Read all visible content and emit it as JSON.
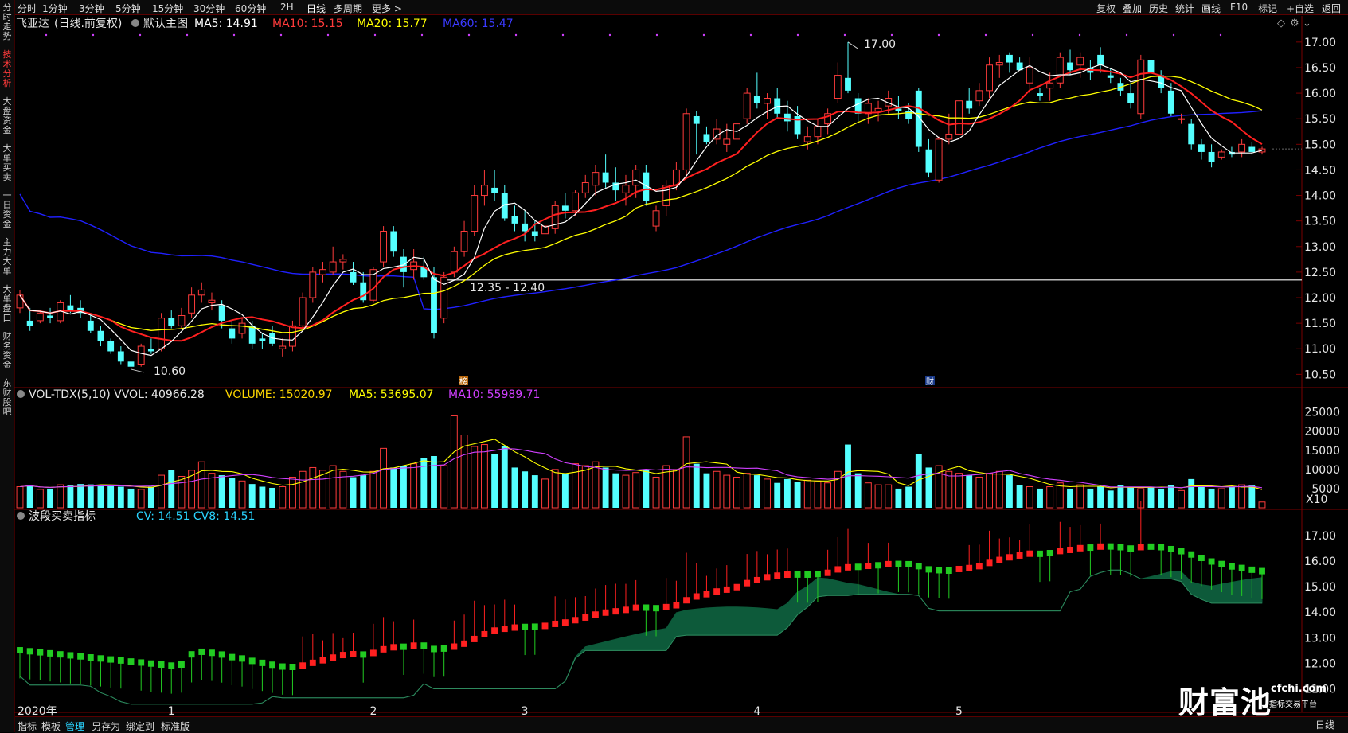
{
  "sidebar": {
    "items": [
      {
        "label": "分时走势",
        "active": false
      },
      {
        "label": "技术分析",
        "active": true
      },
      {
        "label": "大盘资金",
        "active": false
      },
      {
        "label": "大单买卖",
        "active": false
      },
      {
        "label": "一日资金",
        "active": false
      },
      {
        "label": "主力大单",
        "active": false
      },
      {
        "label": "大单盘口",
        "active": false
      },
      {
        "label": "财务资金",
        "active": false
      },
      {
        "label": "东财股吧",
        "active": false
      }
    ]
  },
  "toolbar": {
    "periods": [
      "分时",
      "1分钟",
      "3分钟",
      "5分钟",
      "15分钟",
      "30分钟",
      "60分钟",
      "2H",
      "日线",
      "多周期",
      "更多 >"
    ],
    "active_period": "日线",
    "right_items": [
      "复权",
      "叠加",
      "历史",
      "统计",
      "画线",
      "F10",
      "标记",
      "+自选",
      "返回"
    ]
  },
  "main_chart": {
    "stock_name": "飞亚达",
    "period_label": "(日线.前复权)",
    "template": "默认主图",
    "ma5": "MA5: 14.91",
    "ma10": "MA10: 15.15",
    "ma20": "MA20: 15.77",
    "ma60": "MA60: 15.47",
    "y_labels": [
      "17.00",
      "16.50",
      "16.00",
      "15.50",
      "15.00",
      "14.50",
      "14.00",
      "13.50",
      "13.00",
      "12.50",
      "12.00",
      "11.50",
      "11.00",
      "10.50"
    ],
    "y_range": [
      10.35,
      17.2
    ],
    "high_label": "17.00",
    "low_label": "10.60",
    "range_label": "12.35 - 12.40",
    "support_level": 12.35,
    "marker_bang": "榜",
    "marker_cai": "财",
    "colors": {
      "up": "#ff3b3b",
      "down": "#54ffff",
      "ma5": "#ffffff",
      "ma10": "#ff2020",
      "ma20": "#ffff00",
      "ma60": "#2020ff"
    }
  },
  "volume_panel": {
    "title": "VOL-TDX(5,10) VVOL: 40966.28",
    "volume": "VOLUME: 15020.97",
    "ma5": "MA5: 53695.07",
    "ma10": "MA10: 55989.71",
    "y_labels": [
      "25000",
      "20000",
      "15000",
      "10000",
      "5000"
    ],
    "unit": "X10",
    "y_max": 27000
  },
  "indicator_panel": {
    "title": "波段买卖指标",
    "values": "CV: 14.51  CV8: 14.51",
    "y_labels": [
      "17.00",
      "16.00",
      "15.00",
      "14.00",
      "13.00",
      "12.00",
      "11.00"
    ],
    "y_range": [
      10.3,
      17.4
    ]
  },
  "x_axis": {
    "labels": [
      {
        "label": "2020年",
        "index": 0
      },
      {
        "label": "1",
        "index": 15
      },
      {
        "label": "2",
        "index": 35
      },
      {
        "label": "3",
        "index": 50
      },
      {
        "label": "4",
        "index": 73
      },
      {
        "label": "5",
        "index": 93
      }
    ]
  },
  "chart_data": {
    "type": "candlestick",
    "candles": [
      {
        "o": 11.8,
        "h": 12.15,
        "l": 11.7,
        "c": 12.05,
        "v": 5500
      },
      {
        "o": 11.55,
        "h": 11.8,
        "l": 11.35,
        "c": 11.45,
        "v": 6000
      },
      {
        "o": 11.55,
        "h": 11.75,
        "l": 11.5,
        "c": 11.7,
        "v": 4800
      },
      {
        "o": 11.65,
        "h": 11.8,
        "l": 11.5,
        "c": 11.6,
        "v": 5000
      },
      {
        "o": 11.55,
        "h": 11.95,
        "l": 11.5,
        "c": 11.9,
        "v": 6000
      },
      {
        "o": 11.85,
        "h": 12.05,
        "l": 11.7,
        "c": 11.75,
        "v": 5800
      },
      {
        "o": 11.8,
        "h": 11.95,
        "l": 11.6,
        "c": 11.7,
        "v": 6200
      },
      {
        "o": 11.55,
        "h": 11.65,
        "l": 11.3,
        "c": 11.35,
        "v": 6100
      },
      {
        "o": 11.35,
        "h": 11.45,
        "l": 11.05,
        "c": 11.15,
        "v": 6000
      },
      {
        "o": 11.15,
        "h": 11.2,
        "l": 10.9,
        "c": 10.95,
        "v": 5800
      },
      {
        "o": 10.95,
        "h": 11.05,
        "l": 10.7,
        "c": 10.75,
        "v": 5500
      },
      {
        "o": 10.75,
        "h": 10.9,
        "l": 10.6,
        "c": 10.65,
        "v": 5000
      },
      {
        "o": 10.7,
        "h": 11.1,
        "l": 10.65,
        "c": 11.05,
        "v": 4800
      },
      {
        "o": 11.0,
        "h": 11.2,
        "l": 10.9,
        "c": 10.95,
        "v": 5500
      },
      {
        "o": 11.0,
        "h": 11.7,
        "l": 10.95,
        "c": 11.6,
        "v": 8500
      },
      {
        "o": 11.6,
        "h": 11.75,
        "l": 11.4,
        "c": 11.45,
        "v": 9800
      },
      {
        "o": 11.45,
        "h": 11.8,
        "l": 11.4,
        "c": 11.65,
        "v": 8200
      },
      {
        "o": 11.7,
        "h": 12.2,
        "l": 11.6,
        "c": 12.05,
        "v": 9800
      },
      {
        "o": 12.05,
        "h": 12.3,
        "l": 11.9,
        "c": 12.15,
        "v": 12000
      },
      {
        "o": 11.9,
        "h": 12.1,
        "l": 11.75,
        "c": 11.95,
        "v": 9000
      },
      {
        "o": 11.85,
        "h": 11.95,
        "l": 11.4,
        "c": 11.55,
        "v": 8500
      },
      {
        "o": 11.4,
        "h": 11.55,
        "l": 11.1,
        "c": 11.2,
        "v": 7800
      },
      {
        "o": 11.3,
        "h": 11.6,
        "l": 11.2,
        "c": 11.5,
        "v": 7000
      },
      {
        "o": 11.45,
        "h": 11.55,
        "l": 11.0,
        "c": 11.1,
        "v": 6200
      },
      {
        "o": 11.2,
        "h": 11.3,
        "l": 11.0,
        "c": 11.15,
        "v": 5500
      },
      {
        "o": 11.3,
        "h": 11.45,
        "l": 11.05,
        "c": 11.1,
        "v": 5200
      },
      {
        "o": 11.0,
        "h": 11.2,
        "l": 10.85,
        "c": 11.05,
        "v": 5500
      },
      {
        "o": 11.05,
        "h": 11.55,
        "l": 10.95,
        "c": 11.45,
        "v": 8000
      },
      {
        "o": 11.45,
        "h": 12.1,
        "l": 11.4,
        "c": 12.0,
        "v": 9500
      },
      {
        "o": 12.0,
        "h": 12.6,
        "l": 11.9,
        "c": 12.5,
        "v": 10500
      },
      {
        "o": 12.45,
        "h": 12.7,
        "l": 12.3,
        "c": 12.55,
        "v": 9800
      },
      {
        "o": 12.5,
        "h": 13.0,
        "l": 12.45,
        "c": 12.7,
        "v": 11000
      },
      {
        "o": 12.7,
        "h": 12.85,
        "l": 12.55,
        "c": 12.75,
        "v": 9500
      },
      {
        "o": 12.5,
        "h": 12.7,
        "l": 12.25,
        "c": 12.3,
        "v": 8000
      },
      {
        "o": 12.3,
        "h": 12.5,
        "l": 11.9,
        "c": 11.95,
        "v": 8500
      },
      {
        "o": 11.95,
        "h": 12.6,
        "l": 11.9,
        "c": 12.55,
        "v": 9500
      },
      {
        "o": 12.7,
        "h": 13.4,
        "l": 12.6,
        "c": 13.3,
        "v": 15500
      },
      {
        "o": 13.3,
        "h": 13.4,
        "l": 12.8,
        "c": 12.9,
        "v": 10500
      },
      {
        "o": 12.8,
        "h": 12.95,
        "l": 12.2,
        "c": 12.5,
        "v": 11000
      },
      {
        "o": 12.55,
        "h": 12.95,
        "l": 12.35,
        "c": 12.7,
        "v": 11500
      },
      {
        "o": 12.6,
        "h": 12.8,
        "l": 12.35,
        "c": 12.4,
        "v": 13000
      },
      {
        "o": 12.4,
        "h": 12.6,
        "l": 11.2,
        "c": 11.3,
        "v": 13500
      },
      {
        "o": 11.6,
        "h": 12.5,
        "l": 11.5,
        "c": 12.4,
        "v": 11000
      },
      {
        "o": 12.5,
        "h": 13.0,
        "l": 12.4,
        "c": 12.9,
        "v": 24000
      },
      {
        "o": 12.9,
        "h": 13.5,
        "l": 12.8,
        "c": 13.3,
        "v": 19000
      },
      {
        "o": 13.3,
        "h": 14.2,
        "l": 13.2,
        "c": 14.0,
        "v": 16000
      },
      {
        "o": 14.0,
        "h": 14.5,
        "l": 13.8,
        "c": 14.2,
        "v": 16500
      },
      {
        "o": 14.15,
        "h": 14.5,
        "l": 13.9,
        "c": 14.05,
        "v": 14000
      },
      {
        "o": 14.05,
        "h": 14.2,
        "l": 13.5,
        "c": 13.55,
        "v": 16000
      },
      {
        "o": 13.6,
        "h": 13.8,
        "l": 13.3,
        "c": 13.45,
        "v": 10500
      },
      {
        "o": 13.45,
        "h": 13.7,
        "l": 13.1,
        "c": 13.3,
        "v": 9500
      },
      {
        "o": 13.3,
        "h": 13.5,
        "l": 13.1,
        "c": 13.2,
        "v": 8500
      },
      {
        "o": 13.25,
        "h": 13.5,
        "l": 12.7,
        "c": 13.4,
        "v": 7500
      },
      {
        "o": 13.35,
        "h": 13.9,
        "l": 13.25,
        "c": 13.8,
        "v": 10000
      },
      {
        "o": 13.8,
        "h": 14.05,
        "l": 13.55,
        "c": 13.7,
        "v": 9000
      },
      {
        "o": 13.7,
        "h": 14.1,
        "l": 13.6,
        "c": 14.05,
        "v": 11500
      },
      {
        "o": 14.05,
        "h": 14.4,
        "l": 13.95,
        "c": 14.25,
        "v": 11000
      },
      {
        "o": 14.2,
        "h": 14.6,
        "l": 14.0,
        "c": 14.45,
        "v": 12000
      },
      {
        "o": 14.45,
        "h": 14.8,
        "l": 14.15,
        "c": 14.25,
        "v": 10500
      },
      {
        "o": 14.25,
        "h": 14.55,
        "l": 13.9,
        "c": 14.1,
        "v": 9000
      },
      {
        "o": 14.05,
        "h": 14.4,
        "l": 13.8,
        "c": 14.2,
        "v": 8500
      },
      {
        "o": 14.2,
        "h": 14.6,
        "l": 13.95,
        "c": 14.5,
        "v": 9200
      },
      {
        "o": 14.45,
        "h": 14.6,
        "l": 13.8,
        "c": 13.9,
        "v": 10000
      },
      {
        "o": 13.4,
        "h": 13.8,
        "l": 13.3,
        "c": 13.7,
        "v": 8000
      },
      {
        "o": 13.8,
        "h": 14.3,
        "l": 13.6,
        "c": 14.2,
        "v": 11000
      },
      {
        "o": 14.2,
        "h": 14.65,
        "l": 14.1,
        "c": 14.5,
        "v": 10000
      },
      {
        "o": 14.5,
        "h": 15.7,
        "l": 14.4,
        "c": 15.6,
        "v": 18500
      },
      {
        "o": 15.55,
        "h": 15.65,
        "l": 14.8,
        "c": 15.4,
        "v": 11500
      },
      {
        "o": 15.2,
        "h": 15.35,
        "l": 15.0,
        "c": 15.05,
        "v": 9000
      },
      {
        "o": 15.1,
        "h": 15.5,
        "l": 15.0,
        "c": 15.3,
        "v": 9500
      },
      {
        "o": 15.0,
        "h": 15.4,
        "l": 14.85,
        "c": 15.1,
        "v": 8500
      },
      {
        "o": 15.1,
        "h": 15.5,
        "l": 14.95,
        "c": 15.4,
        "v": 8000
      },
      {
        "o": 15.5,
        "h": 16.1,
        "l": 15.4,
        "c": 16.0,
        "v": 9000
      },
      {
        "o": 15.95,
        "h": 16.4,
        "l": 15.7,
        "c": 15.8,
        "v": 8500
      },
      {
        "o": 15.8,
        "h": 16.0,
        "l": 15.5,
        "c": 15.9,
        "v": 7500
      },
      {
        "o": 15.9,
        "h": 16.1,
        "l": 15.5,
        "c": 15.6,
        "v": 6500
      },
      {
        "o": 15.6,
        "h": 15.85,
        "l": 15.25,
        "c": 15.45,
        "v": 7500
      },
      {
        "o": 15.55,
        "h": 15.75,
        "l": 15.1,
        "c": 15.2,
        "v": 6800
      },
      {
        "o": 15.05,
        "h": 15.35,
        "l": 14.9,
        "c": 15.15,
        "v": 7200
      },
      {
        "o": 15.15,
        "h": 15.5,
        "l": 15.0,
        "c": 15.35,
        "v": 7000
      },
      {
        "o": 15.4,
        "h": 15.7,
        "l": 15.2,
        "c": 15.6,
        "v": 6500
      },
      {
        "o": 15.9,
        "h": 16.6,
        "l": 15.8,
        "c": 16.35,
        "v": 9500
      },
      {
        "o": 16.3,
        "h": 17.0,
        "l": 16.0,
        "c": 16.05,
        "v": 16500
      },
      {
        "o": 15.9,
        "h": 16.0,
        "l": 15.45,
        "c": 15.6,
        "v": 9000
      },
      {
        "o": 15.6,
        "h": 15.9,
        "l": 15.4,
        "c": 15.8,
        "v": 6500
      },
      {
        "o": 15.65,
        "h": 15.85,
        "l": 15.45,
        "c": 15.7,
        "v": 6000
      },
      {
        "o": 15.75,
        "h": 16.05,
        "l": 15.6,
        "c": 15.9,
        "v": 6000
      },
      {
        "o": 15.7,
        "h": 15.95,
        "l": 15.5,
        "c": 15.65,
        "v": 5000
      },
      {
        "o": 15.65,
        "h": 15.8,
        "l": 15.4,
        "c": 15.5,
        "v": 5500
      },
      {
        "o": 16.05,
        "h": 16.1,
        "l": 14.85,
        "c": 14.95,
        "v": 14000
      },
      {
        "o": 14.9,
        "h": 15.1,
        "l": 14.35,
        "c": 14.45,
        "v": 10500
      },
      {
        "o": 14.3,
        "h": 15.15,
        "l": 14.25,
        "c": 15.1,
        "v": 11000
      },
      {
        "o": 15.1,
        "h": 15.6,
        "l": 15.0,
        "c": 15.2,
        "v": 9500
      },
      {
        "o": 15.2,
        "h": 15.95,
        "l": 15.1,
        "c": 15.85,
        "v": 9000
      },
      {
        "o": 15.85,
        "h": 16.1,
        "l": 15.6,
        "c": 15.7,
        "v": 8500
      },
      {
        "o": 15.85,
        "h": 16.2,
        "l": 15.75,
        "c": 16.05,
        "v": 8000
      },
      {
        "o": 16.05,
        "h": 16.7,
        "l": 15.9,
        "c": 16.55,
        "v": 9000
      },
      {
        "o": 16.55,
        "h": 16.75,
        "l": 16.3,
        "c": 16.6,
        "v": 9500
      },
      {
        "o": 16.75,
        "h": 16.8,
        "l": 16.4,
        "c": 16.6,
        "v": 8500
      },
      {
        "o": 16.6,
        "h": 16.7,
        "l": 16.45,
        "c": 16.45,
        "v": 6000
      },
      {
        "o": 16.2,
        "h": 16.7,
        "l": 16.0,
        "c": 16.5,
        "v": 5500
      },
      {
        "o": 16.0,
        "h": 16.1,
        "l": 15.85,
        "c": 15.95,
        "v": 5000
      },
      {
        "o": 16.1,
        "h": 16.4,
        "l": 15.85,
        "c": 16.2,
        "v": 5500
      },
      {
        "o": 16.2,
        "h": 16.8,
        "l": 16.1,
        "c": 16.7,
        "v": 6500
      },
      {
        "o": 16.6,
        "h": 16.85,
        "l": 16.35,
        "c": 16.45,
        "v": 5000
      },
      {
        "o": 16.55,
        "h": 16.8,
        "l": 16.3,
        "c": 16.7,
        "v": 6000
      },
      {
        "o": 16.5,
        "h": 16.65,
        "l": 16.25,
        "c": 16.4,
        "v": 5000
      },
      {
        "o": 16.75,
        "h": 16.9,
        "l": 16.4,
        "c": 16.55,
        "v": 5500
      },
      {
        "o": 16.35,
        "h": 16.5,
        "l": 16.2,
        "c": 16.3,
        "v": 4500
      },
      {
        "o": 16.2,
        "h": 16.3,
        "l": 15.95,
        "c": 16.05,
        "v": 6000
      },
      {
        "o": 16.0,
        "h": 16.2,
        "l": 15.7,
        "c": 15.8,
        "v": 5500
      },
      {
        "o": 15.6,
        "h": 16.75,
        "l": 15.5,
        "c": 16.65,
        "v": 5000
      },
      {
        "o": 16.65,
        "h": 16.7,
        "l": 16.3,
        "c": 16.4,
        "v": 5500
      },
      {
        "o": 16.35,
        "h": 16.45,
        "l": 16.0,
        "c": 16.1,
        "v": 5000
      },
      {
        "o": 16.05,
        "h": 16.2,
        "l": 15.55,
        "c": 15.6,
        "v": 6000
      },
      {
        "o": 15.5,
        "h": 15.6,
        "l": 15.4,
        "c": 15.5,
        "v": 4500
      },
      {
        "o": 15.4,
        "h": 15.5,
        "l": 14.9,
        "c": 15.0,
        "v": 7500
      },
      {
        "o": 15.0,
        "h": 15.1,
        "l": 14.7,
        "c": 14.85,
        "v": 5500
      },
      {
        "o": 14.85,
        "h": 15.0,
        "l": 14.55,
        "c": 14.65,
        "v": 5000
      },
      {
        "o": 14.75,
        "h": 14.9,
        "l": 14.7,
        "c": 14.85,
        "v": 5000
      },
      {
        "o": 14.85,
        "h": 14.95,
        "l": 14.75,
        "c": 14.8,
        "v": 5500
      },
      {
        "o": 14.85,
        "h": 15.1,
        "l": 14.75,
        "c": 15.0,
        "v": 6000
      },
      {
        "o": 14.95,
        "h": 15.05,
        "l": 14.8,
        "c": 14.85,
        "v": 5800
      },
      {
        "o": 14.85,
        "h": 14.95,
        "l": 14.8,
        "c": 14.91,
        "v": 1500
      }
    ]
  }
}
